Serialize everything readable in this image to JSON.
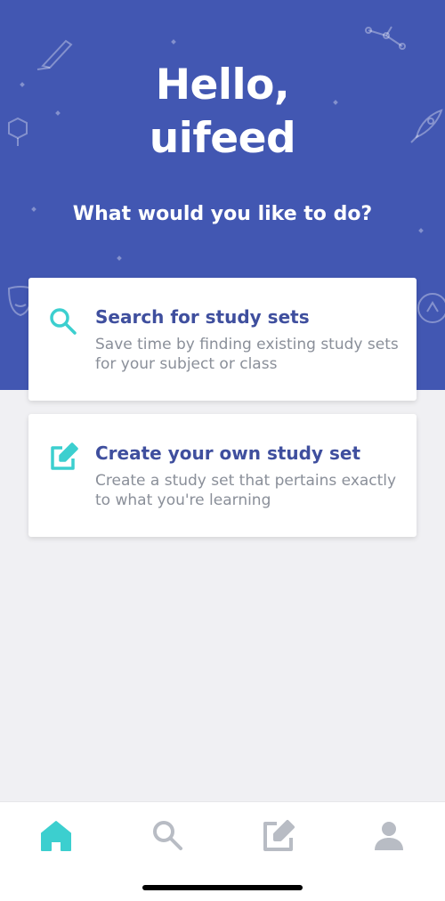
{
  "hero": {
    "greeting_line1": "Hello,",
    "greeting_line2": "uifeed",
    "subtitle": "What would you like to do?",
    "background_color": "#4257b2"
  },
  "cards": [
    {
      "title": "Search for study sets",
      "description": "Save time by finding existing study sets for your subject or class",
      "icon": "search-icon",
      "icon_color": "#3ccfcf"
    },
    {
      "title": "Create your own study set",
      "description": "Create a study set that pertains exactly to what you're learning",
      "icon": "edit-icon",
      "icon_color": "#3ccfcf"
    }
  ],
  "tabbar": {
    "items": [
      {
        "icon": "home-icon",
        "active": true
      },
      {
        "icon": "search-icon",
        "active": false
      },
      {
        "icon": "edit-icon",
        "active": false
      },
      {
        "icon": "profile-icon",
        "active": false
      }
    ],
    "active_color": "#3ccfcf",
    "inactive_color": "#b8bcc4"
  }
}
